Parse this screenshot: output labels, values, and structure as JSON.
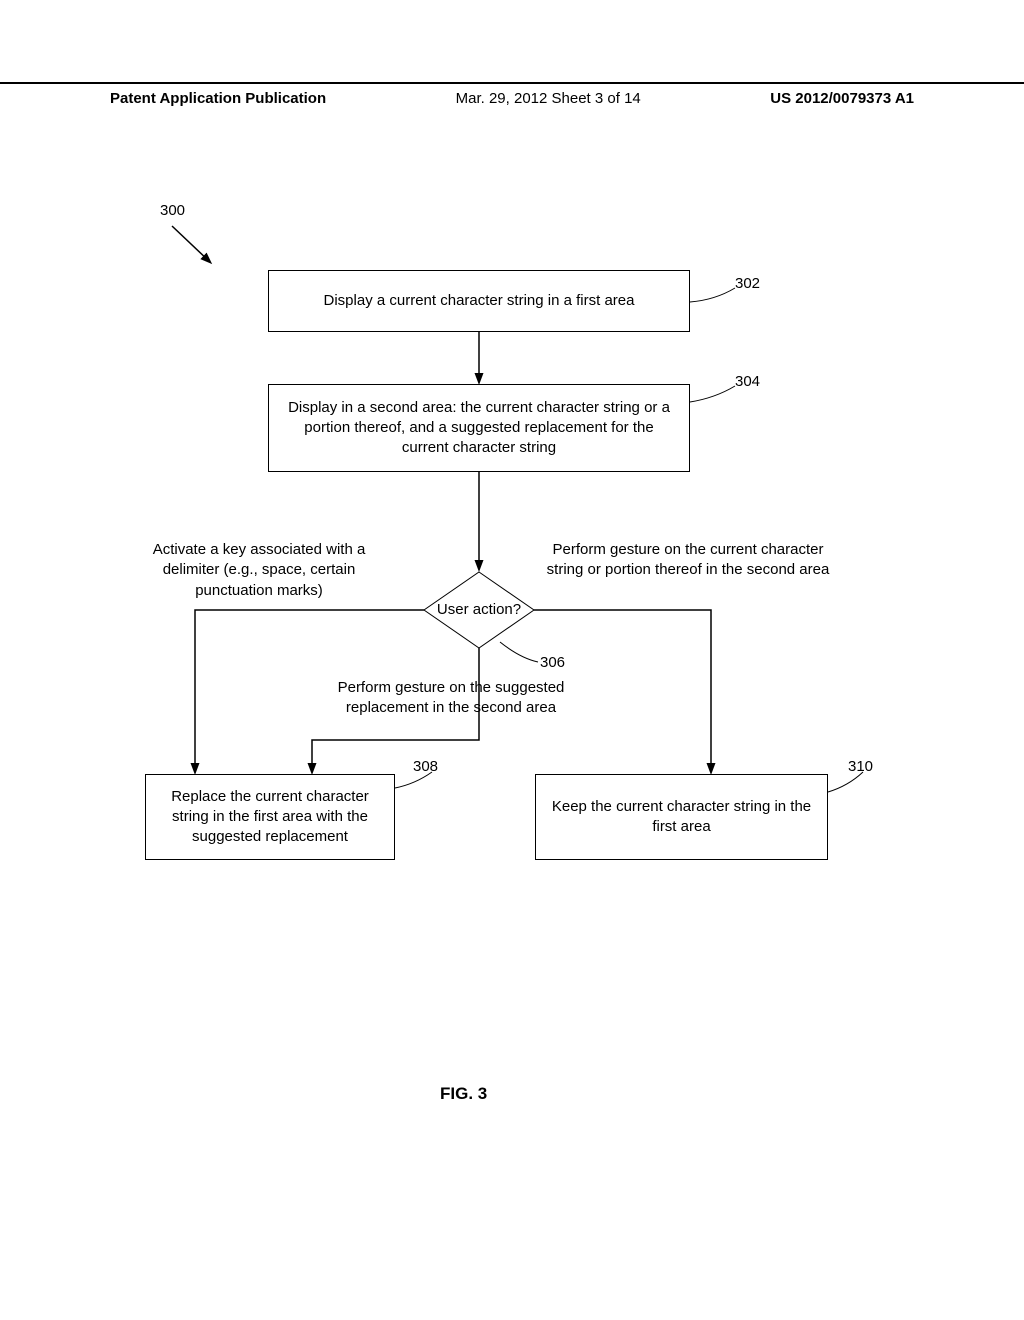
{
  "header": {
    "left": "Patent Application Publication",
    "mid": "Mar. 29, 2012  Sheet 3 of 14",
    "right": "US 2012/0079373 A1"
  },
  "figure_ref": "300",
  "boxes": {
    "b302": {
      "text": "Display a current character string in a first area",
      "ref": "302"
    },
    "b304": {
      "text": "Display in a second area: the current character string or a portion thereof, and a suggested replacement for the current character string",
      "ref": "304"
    },
    "b306": {
      "text": "User action?",
      "ref": "306"
    },
    "b308": {
      "text": "Replace the current character string in the first area with the suggested replacement",
      "ref": "308"
    },
    "b310": {
      "text": "Keep the current character string in the first area",
      "ref": "310"
    }
  },
  "branch_labels": {
    "left": "Activate a key associated with a delimiter (e.g., space, certain punctuation marks)",
    "right": "Perform gesture on the current character string or portion thereof in the second area",
    "bottom": "Perform gesture on the suggested replacement in the second area"
  },
  "caption": "FIG. 3",
  "chart_data": {
    "type": "flowchart",
    "nodes": [
      {
        "id": "302",
        "type": "process",
        "text": "Display a current character string in a first area"
      },
      {
        "id": "304",
        "type": "process",
        "text": "Display in a second area: the current character string or a portion thereof, and a suggested replacement for the current character string"
      },
      {
        "id": "306",
        "type": "decision",
        "text": "User action?"
      },
      {
        "id": "308",
        "type": "process",
        "text": "Replace the current character string in the first area with the suggested replacement"
      },
      {
        "id": "310",
        "type": "process",
        "text": "Keep the current character string in the first area"
      }
    ],
    "edges": [
      {
        "from": "302",
        "to": "304"
      },
      {
        "from": "304",
        "to": "306"
      },
      {
        "from": "306",
        "to": "308",
        "label": "Activate a key associated with a delimiter (e.g., space, certain punctuation marks)"
      },
      {
        "from": "306",
        "to": "308",
        "label": "Perform gesture on the suggested replacement in the second area"
      },
      {
        "from": "306",
        "to": "310",
        "label": "Perform gesture on the current character string or portion thereof in the second area"
      }
    ],
    "entry_ref": "300"
  }
}
